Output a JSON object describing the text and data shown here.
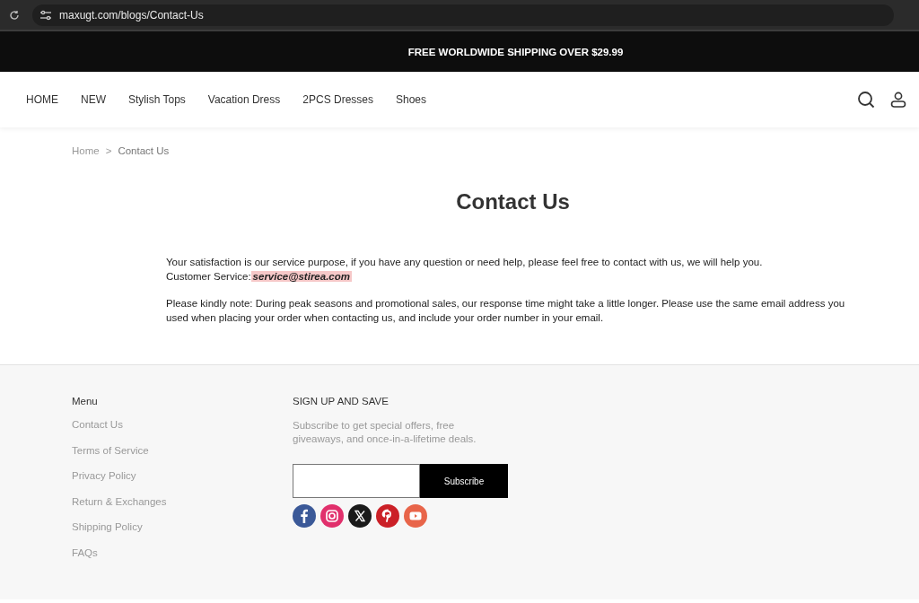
{
  "browser": {
    "url": "maxugt.com/blogs/Contact-Us"
  },
  "announcement": "FREE WORLDWIDE SHIPPING OVER $29.99",
  "nav": {
    "items": [
      "HOME",
      "NEW",
      "Stylish Tops",
      "Vacation Dress",
      "2PCS Dresses",
      "Shoes"
    ]
  },
  "breadcrumb": {
    "items": [
      "Home",
      "Contact Us"
    ],
    "separator": ">"
  },
  "title": "Contact Us",
  "intro": "Your satisfaction is our service purpose, if you have any question or need help, please feel free to contact with us, we will help you.",
  "customer_service": {
    "label": "Customer Service:",
    "email": "service@stirea.com"
  },
  "note": "Please kindly note: During peak seasons and promotional sales, our response time might take a little longer. Please use the same email address you used when placing your order when contacting us, and include your order number in your email.",
  "footer": {
    "menu": {
      "heading": "Menu",
      "items": [
        "Contact Us",
        "Terms of Service",
        "Privacy Policy",
        "Return & Exchanges",
        "Shipping Policy",
        "FAQs"
      ]
    },
    "signup": {
      "heading": "SIGN UP AND SAVE",
      "text": "Subscribe to get special offers, free giveaways, and once-in-a-lifetime deals.",
      "button": "Subscribe"
    },
    "social": [
      {
        "kind": "facebook"
      },
      {
        "kind": "instagram"
      },
      {
        "kind": "x"
      },
      {
        "kind": "pinterest"
      },
      {
        "kind": "youtube"
      }
    ]
  }
}
